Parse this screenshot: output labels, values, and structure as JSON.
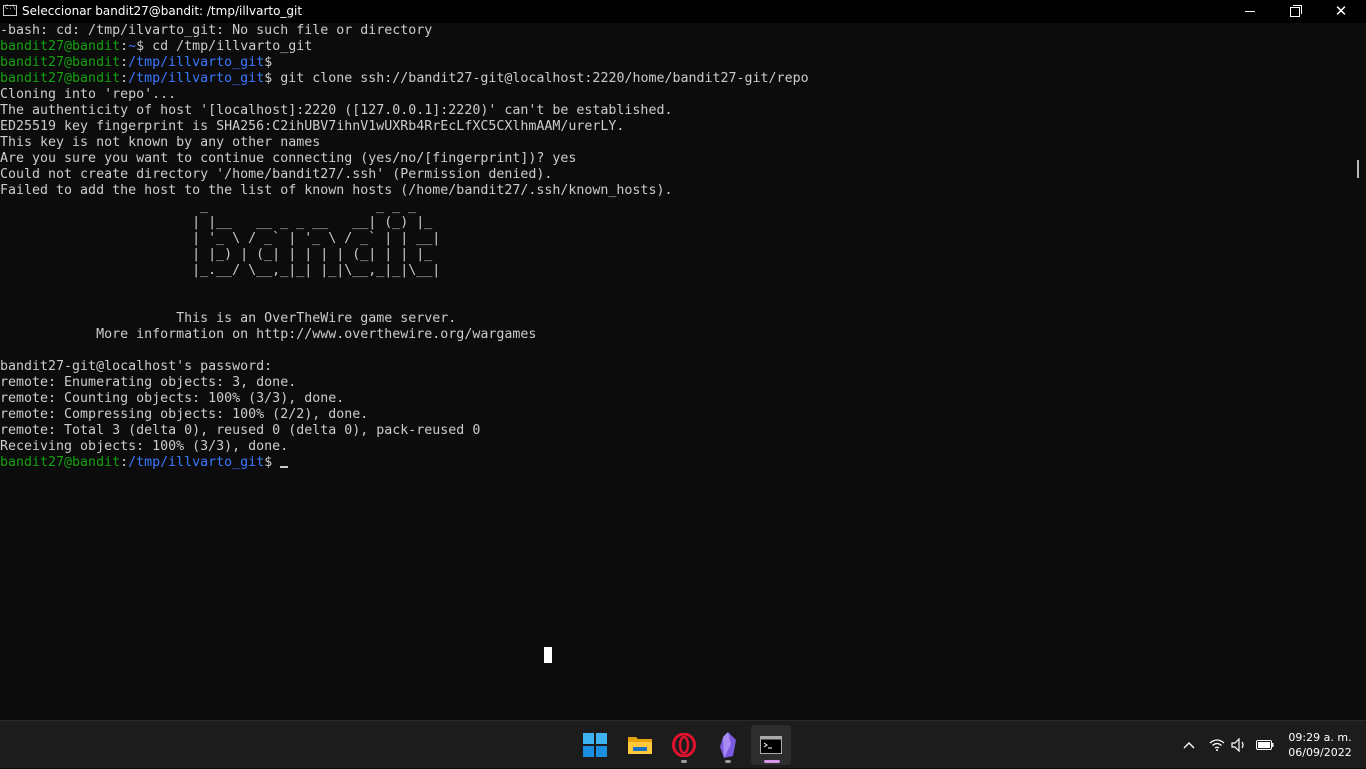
{
  "window": {
    "title": "Seleccionar bandit27@bandit: /tmp/illvarto_git",
    "icon": "cmd-terminal-icon",
    "controls": [
      "minimize",
      "maximize",
      "close"
    ]
  },
  "terminal": {
    "colors": {
      "foreground": "#cccccc",
      "user_host": "#13a10e",
      "path": "#3b78ff",
      "background": "#0c0c0c"
    },
    "lines": {
      "l1": "-bash: cd: /tmp/ilvarto_git: No such file or directory",
      "l2": {
        "user": "bandit27@bandit",
        "colon": ":",
        "path": "~",
        "prompt": "$",
        "cmd": " cd /tmp/illvarto_git"
      },
      "l3": {
        "user": "bandit27@bandit",
        "colon": ":",
        "path": "/tmp/illvarto_git",
        "prompt": "$",
        "cmd": ""
      },
      "l4": {
        "user": "bandit27@bandit",
        "colon": ":",
        "path": "/tmp/illvarto_git",
        "prompt": "$",
        "cmd": " git clone ssh://bandit27-git@localhost:2220/home/bandit27-git/repo"
      },
      "l5": "Cloning into 'repo'...",
      "l6": "The authenticity of host '[localhost]:2220 ([127.0.0.1]:2220)' can't be established.",
      "l7": "ED25519 key fingerprint is SHA256:C2ihUBV7ihnV1wUXRb4RrEcLfXC5CXlhmAAM/urerLY.",
      "l8": "This key is not known by any other names",
      "l9": "Are you sure you want to continue connecting (yes/no/[fingerprint])? yes",
      "l10": "Could not create directory '/home/bandit27/.ssh' (Permission denied).",
      "l11": "Failed to add the host to the list of known hosts (/home/bandit27/.ssh/known_hosts).",
      "banner1": "                         _                     _ _ _   ",
      "banner2": "                        | |__   __ _ _ __   __| (_) |_ ",
      "banner3": "                        | '_ \\ / _` | '_ \\ / _` | | __|",
      "banner4": "                        | |_) | (_| | | | | (_| | | |_ ",
      "banner5": "                        |_.__/ \\__,_|_| |_|\\__,_|_|\\__|",
      "motd1": "                      This is an OverTheWire game server.",
      "motd2": "            More information on http://www.overthewire.org/wargames",
      "l12": "bandit27-git@localhost's password:",
      "l13": "remote: Enumerating objects: 3, done.",
      "l14": "remote: Counting objects: 100% (3/3), done.",
      "l15": "remote: Compressing objects: 100% (2/2), done.",
      "l16": "remote: Total 3 (delta 0), reused 0 (delta 0), pack-reused 0",
      "l17": "Receiving objects: 100% (3/3), done.",
      "l18": {
        "user": "bandit27@bandit",
        "colon": ":",
        "path": "/tmp/illvarto_git",
        "prompt": "$ ",
        "cmd": ""
      }
    }
  },
  "taskbar": {
    "apps": [
      {
        "name": "start",
        "icon": "windows-start-icon"
      },
      {
        "name": "file-explorer",
        "icon": "folder-icon"
      },
      {
        "name": "opera",
        "icon": "opera-icon"
      },
      {
        "name": "obsidian",
        "icon": "obsidian-icon"
      },
      {
        "name": "terminal",
        "icon": "terminal-icon",
        "active": true
      }
    ],
    "tray": {
      "icons": [
        "chevron-up-icon",
        "wifi-icon",
        "volume-icon",
        "battery-icon"
      ],
      "time": "09:29 a. m.",
      "date": "06/09/2022"
    }
  }
}
